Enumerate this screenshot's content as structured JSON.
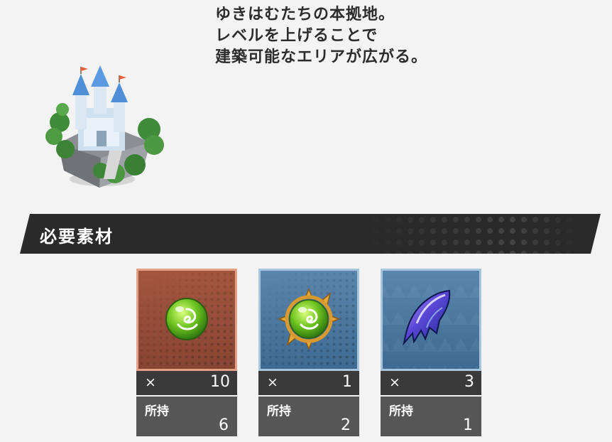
{
  "description": {
    "line1": "ゆきはむたちの本拠地。",
    "line2": "レベルを上げることで",
    "line3": "建築可能なエリアが広がる。"
  },
  "section_title": "必要素材",
  "colors": {
    "banner": "#2a2a2a",
    "card_brown": "#a4563f",
    "card_blue": "#5a86ad",
    "qty_bar": "#3a3a3a",
    "owned_bar": "#565656"
  },
  "materials": [
    {
      "icon": "green-orb-icon",
      "rarity": "brown",
      "x_label": "×",
      "required": "10",
      "owned_label": "所持",
      "owned": "6"
    },
    {
      "icon": "green-orb-gold-frame-icon",
      "rarity": "blue",
      "x_label": "×",
      "required": "1",
      "owned_label": "所持",
      "owned": "2"
    },
    {
      "icon": "blue-crystal-claw-icon",
      "rarity": "blue",
      "x_label": "×",
      "required": "3",
      "owned_label": "所持",
      "owned": "1"
    }
  ]
}
